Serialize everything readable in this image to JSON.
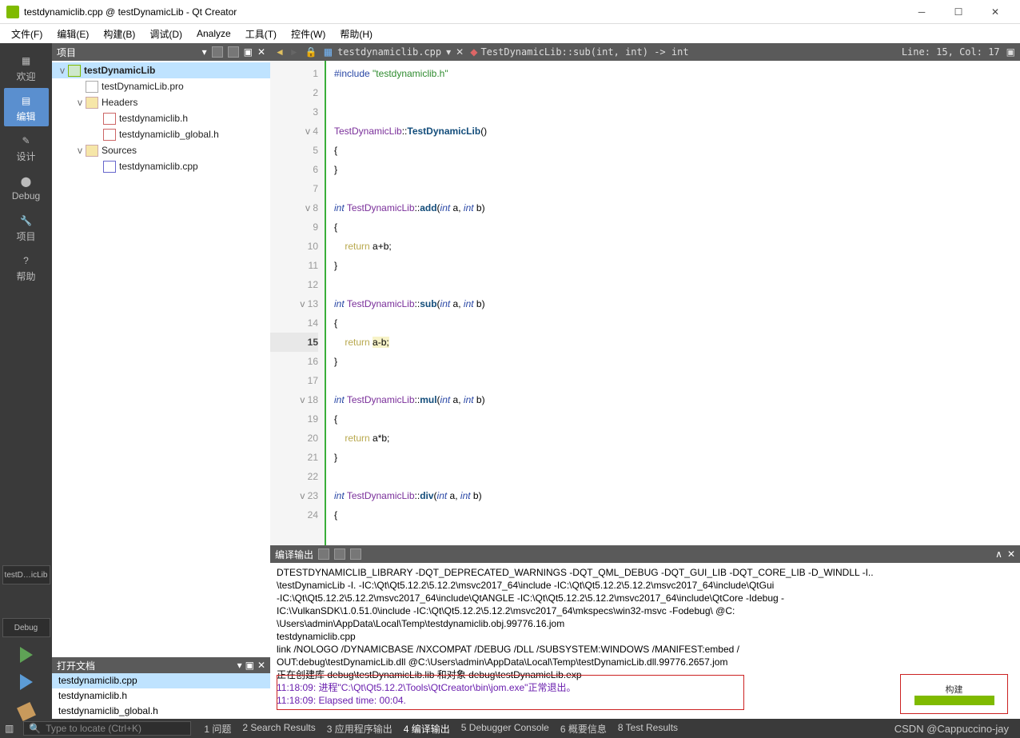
{
  "window": {
    "title": "testdynamiclib.cpp @ testDynamicLib - Qt Creator"
  },
  "menubar": [
    "文件(F)",
    "编辑(E)",
    "构建(B)",
    "调试(D)",
    "Analyze",
    "工具(T)",
    "控件(W)",
    "帮助(H)"
  ],
  "leftbar": {
    "items": [
      {
        "icon": "grid",
        "label": "欢迎"
      },
      {
        "icon": "edit",
        "label": "编辑",
        "active": true
      },
      {
        "icon": "pen",
        "label": "设计"
      },
      {
        "icon": "bug",
        "label": "Debug"
      },
      {
        "icon": "wrench",
        "label": "项目"
      },
      {
        "icon": "help",
        "label": "帮助"
      }
    ],
    "kit": "testD…icLib",
    "mode": "Debug"
  },
  "project_panel": {
    "title": "项目",
    "tree": [
      {
        "d": 0,
        "tw": "v",
        "ic": "ic-proj",
        "label": "testDynamicLib",
        "sel": true,
        "bold": true
      },
      {
        "d": 1,
        "tw": "",
        "ic": "ic-pro",
        "label": "testDynamicLib.pro"
      },
      {
        "d": 1,
        "tw": "v",
        "ic": "ic-fold",
        "label": "Headers"
      },
      {
        "d": 2,
        "tw": "",
        "ic": "ic-h",
        "label": "testdynamiclib.h"
      },
      {
        "d": 2,
        "tw": "",
        "ic": "ic-h",
        "label": "testdynamiclib_global.h"
      },
      {
        "d": 1,
        "tw": "v",
        "ic": "ic-fold",
        "label": "Sources"
      },
      {
        "d": 2,
        "tw": "",
        "ic": "ic-cpp",
        "label": "testdynamiclib.cpp"
      }
    ]
  },
  "open_docs": {
    "title": "打开文档",
    "items": [
      {
        "label": "testdynamiclib.cpp",
        "sel": true
      },
      {
        "label": "testdynamiclib.h"
      },
      {
        "label": "testdynamiclib_global.h"
      }
    ]
  },
  "editor": {
    "tab": "testdynamiclib.cpp",
    "ctx": "TestDynamicLib::sub(int, int) -> int",
    "pos": "Line: 15, Col: 17",
    "lines": [
      {
        "n": 1,
        "f": "",
        "html": "<span class='ppd'>#include</span> <span class='str'>\"testdynamiclib.h\"</span>"
      },
      {
        "n": 2,
        "f": "",
        "html": ""
      },
      {
        "n": 3,
        "f": "",
        "html": ""
      },
      {
        "n": 4,
        "f": "v",
        "html": "<span class='cls'>TestDynamicLib</span>::<span class='fn'>TestDynamicLib</span>()"
      },
      {
        "n": 5,
        "f": "",
        "html": "{"
      },
      {
        "n": 6,
        "f": "",
        "html": "}"
      },
      {
        "n": 7,
        "f": "",
        "html": ""
      },
      {
        "n": 8,
        "f": "v",
        "html": "<span class='type'>int</span> <span class='cls'>TestDynamicLib</span>::<span class='fn'>add</span>(<span class='type'>int</span> a, <span class='type'>int</span> b)"
      },
      {
        "n": 9,
        "f": "",
        "html": "{"
      },
      {
        "n": 10,
        "f": "",
        "html": "    <span class='kw'>return</span> a+b;"
      },
      {
        "n": 11,
        "f": "",
        "html": "}"
      },
      {
        "n": 12,
        "f": "",
        "html": ""
      },
      {
        "n": 13,
        "f": "v",
        "html": "<span class='type'>int</span> <span class='cls'>TestDynamicLib</span>::<span class='fn'>sub</span>(<span class='type'>int</span> a, <span class='type'>int</span> b)"
      },
      {
        "n": 14,
        "f": "",
        "html": "{"
      },
      {
        "n": 15,
        "f": "",
        "cur": true,
        "html": "    <span class='kw'>return</span> <span class='hl'>a-b;</span>"
      },
      {
        "n": 16,
        "f": "",
        "html": "}"
      },
      {
        "n": 17,
        "f": "",
        "html": ""
      },
      {
        "n": 18,
        "f": "v",
        "html": "<span class='type'>int</span> <span class='cls'>TestDynamicLib</span>::<span class='fn'>mul</span>(<span class='type'>int</span> a, <span class='type'>int</span> b)"
      },
      {
        "n": 19,
        "f": "",
        "html": "{"
      },
      {
        "n": 20,
        "f": "",
        "html": "    <span class='kw'>return</span> a*b;"
      },
      {
        "n": 21,
        "f": "",
        "html": "}"
      },
      {
        "n": 22,
        "f": "",
        "html": ""
      },
      {
        "n": 23,
        "f": "v",
        "html": "<span class='type'>int</span> <span class='cls'>TestDynamicLib</span>::<span class='fn'>div</span>(<span class='type'>int</span> a, <span class='type'>int</span> b)"
      },
      {
        "n": 24,
        "f": "",
        "html": "{"
      }
    ]
  },
  "output": {
    "title": "编译输出",
    "lines": [
      "DTESTDYNAMICLIB_LIBRARY -DQT_DEPRECATED_WARNINGS -DQT_QML_DEBUG -DQT_GUI_LIB -DQT_CORE_LIB -D_WINDLL -I..",
      "\\testDynamicLib -I. -IC:\\Qt\\Qt5.12.2\\5.12.2\\msvc2017_64\\include -IC:\\Qt\\Qt5.12.2\\5.12.2\\msvc2017_64\\include\\QtGui",
      "-IC:\\Qt\\Qt5.12.2\\5.12.2\\msvc2017_64\\include\\QtANGLE -IC:\\Qt\\Qt5.12.2\\5.12.2\\msvc2017_64\\include\\QtCore -Idebug -",
      "IC:\\VulkanSDK\\1.0.51.0\\include -IC:\\Qt\\Qt5.12.2\\5.12.2\\msvc2017_64\\mkspecs\\win32-msvc -Fodebug\\ @C:",
      "\\Users\\admin\\AppData\\Local\\Temp\\testdynamiclib.obj.99776.16.jom",
      "testdynamiclib.cpp",
      "        link /NOLOGO /DYNAMICBASE /NXCOMPAT /DEBUG /DLL /SUBSYSTEM:WINDOWS /MANIFEST:embed /",
      "OUT:debug\\testDynamicLib.dll @C:\\Users\\admin\\AppData\\Local\\Temp\\testDynamicLib.dll.99776.2657.jom",
      "   正在创建库 debug\\testDynamicLib.lib 和对象 debug\\testDynamicLib.exp"
    ],
    "hl": [
      "11:18:09: 进程\"C:\\Qt\\Qt5.12.2\\Tools\\QtCreator\\bin\\jom.exe\"正常退出。",
      "11:18:09: Elapsed time: 00:04."
    ]
  },
  "status": {
    "locator": "Type to locate (Ctrl+K)",
    "tabs": [
      "1 问题",
      "2 Search Results",
      "3 应用程序输出",
      "4 编译输出",
      "5 Debugger Console",
      "6 概要信息",
      "8 Test Results"
    ],
    "active": 3
  },
  "buildbadge": "构建",
  "watermark": "CSDN @Cappuccino-jay"
}
